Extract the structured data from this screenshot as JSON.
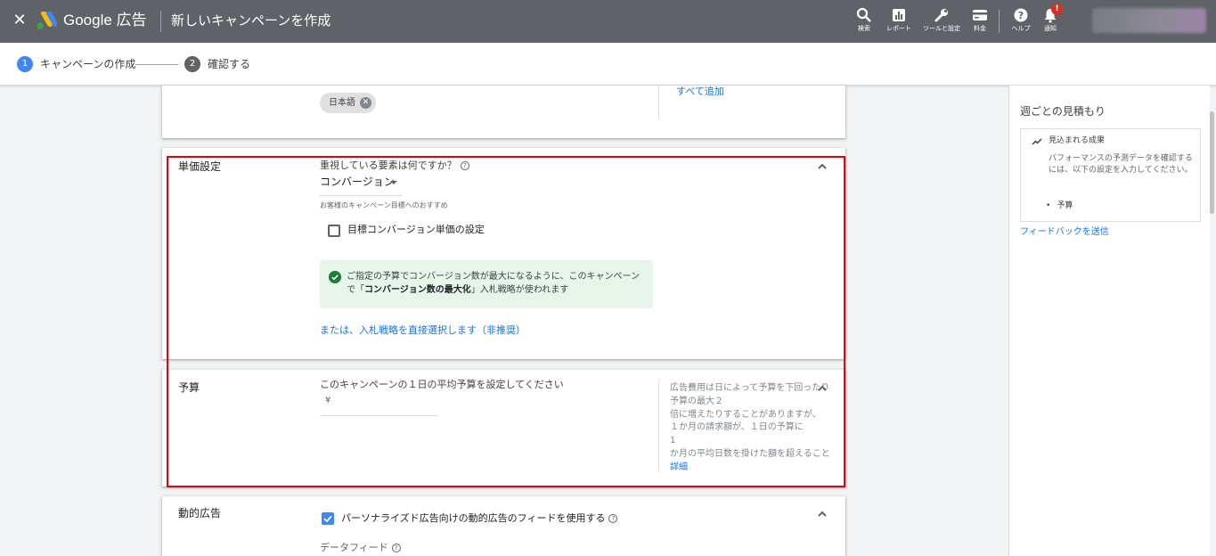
{
  "header": {
    "close_icon": "close-icon",
    "product_name": "Google 広告",
    "page_title": "新しいキャンペーンを作成",
    "tools": [
      {
        "icon": "search-icon",
        "label": "検索"
      },
      {
        "icon": "report-icon",
        "label": "レポート"
      },
      {
        "icon": "wrench-icon",
        "label": "ツールと設定"
      },
      {
        "icon": "billing-icon",
        "label": "料金"
      },
      {
        "icon": "help-icon",
        "label": "ヘルプ"
      },
      {
        "icon": "bell-icon",
        "label": "通知"
      }
    ],
    "notification_badge": "!"
  },
  "steps": [
    {
      "number": "1",
      "label": "キャンペーンの作成",
      "active": true
    },
    {
      "number": "2",
      "label": "確認する",
      "active": false
    }
  ],
  "language_section": {
    "chip_label": "日本語",
    "add_all_link": "すべて追加"
  },
  "bidding": {
    "title": "単価設定",
    "question": "重視している要素は何ですか？",
    "selected": "コンバージョン",
    "recommendation": "お客様のキャンペーン目標へのおすすめ",
    "target_cpa_label": "目標コンバージョン単価の設定",
    "target_cpa_checked": false,
    "notice_line1": "ご指定の予算でコンバージョン数が最大になるように、このキャンペーン",
    "notice_line2_pre": "で「",
    "notice_line2_bold": "コンバージョン数の最大化",
    "notice_line2_post": "」入札戦略が使われます",
    "direct_link": "または、入札戦略を直接選択します（非推奨）"
  },
  "budget": {
    "title": "予算",
    "prompt": "このキャンペーンの１日の平均予算を設定してください",
    "currency": "¥",
    "note_lines": [
      "広告費用は日によって予算を下回ったり、",
      "予算の最大２",
      "倍に増えたりすることがありますが、",
      "１か月の請求額が、１日の予算に",
      "1",
      "か月の平均日数を掛けた額を超えることはありません。"
    ],
    "details_link": "詳細"
  },
  "dynamic_ads": {
    "title": "動的広告",
    "checkbox_label": "パーソナライズド広告向けの動的広告のフィードを使用する",
    "checked": true,
    "data_feed_label": "データフィード"
  },
  "right_panel": {
    "title": "週ごとの見積もり",
    "box_heading": "見込まれる成果",
    "box_body": "パフォーマンスの予測データを確認するには、以下の設定を入力してください。",
    "bullet": "予算",
    "feedback_link": "フィードバックを送信"
  },
  "colors": {
    "header_bg": "#5f6368",
    "accent": "#1a73e8",
    "highlight_border": "#e8000b",
    "notice_bg": "#e6f4ea",
    "success": "#188038"
  }
}
